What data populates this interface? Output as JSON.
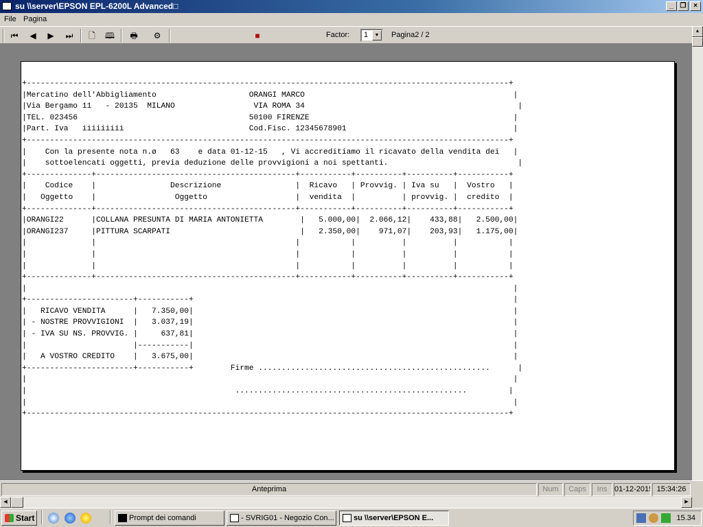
{
  "window": {
    "title": "su \\\\server\\EPSON EPL-6200L Advanced□"
  },
  "menu": {
    "file": "File",
    "page": "Pagina"
  },
  "toolbar": {
    "factor_label": "Factor:",
    "factor_value": "1",
    "page_indicator": "Pagina2 / 2",
    "icons": [
      "separator-grip-icon",
      "first-page-icon",
      "previous-page-icon",
      "next-page-icon",
      "last-page-icon",
      "single-page-icon",
      "two-pages-icon",
      "print-icon",
      "print-setup-icon",
      "exit-icon"
    ]
  },
  "report": {
    "lines": [
      "+--------------------------------------------------------------------------------------------------------+",
      "|Mercatino dell'Abbigliamento                    ORANGI MARCO                                             |",
      "|Via Bergamo 11   - 20135  MILANO                 VIA ROMA 34                                              |",
      "|TEL. 023456                                     50100 FIRENZE                                            |",
      "|Part. Iva   iiiiiiiii                           Cod.Fisc. 12345678901                                    |",
      "+--------------------------------------------------------------------------------------------------------+",
      "|    Con la presente nota n.ø   63    e data 01-12-15   , Vi accreditiamo il ricavato della vendita dei   |",
      "|    sottoelencati oggetti, previa deduzione delle provvigioni a noi spettanti.                            |",
      "+--------------+-------------------------------------------+-----------+----------+----------+-----------+",
      "|    Codice    |                Descrizione                |  Ricavo   | Provvig. | Iva su   |  Vostro   |",
      "|   Oggetto    |                 Oggetto                   |  vendita  |          | provvig. |  credito  |",
      "+--------------+-------------------------------------------+-----------+----------+----------+-----------+",
      "|ORANGI22      |COLLANA PRESUNTA DI MARIA ANTONIETTA        |   5.000,00|  2.066,12|    433,88|   2.500,00|",
      "|ORANGI237     |PITTURA SCARPATI                            |   2.350,00|    971,07|    203,93|   1.175,00|",
      "|              |                                           |           |          |          |           |",
      "|              |                                           |           |          |          |           |",
      "|              |                                           |           |          |          |           |",
      "+--------------+-------------------------------------------+-----------+----------+----------+-----------+",
      "|                                                                                                         |",
      "+-----------------------+-----------+                                                                     |",
      "|   RICAVO VENDITA      |   7.350,00|                                                                     |",
      "| - NOSTRE PROVVIGIONI  |   3.037,19|                                                                     |",
      "| - IVA SU NS. PROVVIG. |     637,81|                                                                     |",
      "|                       |-----------|                                                                     |",
      "|   A VOSTRO CREDITO    |   3.675,00|                                                                     |",
      "+-----------------------+-----------+        Firme ..................................................      |",
      "|                                                                                                         |",
      "|                                             ..................................................         |",
      "|                                                                                                         |",
      "+--------------------------------------------------------------------------------------------------------+"
    ]
  },
  "statusbar": {
    "center": "Anteprima",
    "num": "Num",
    "caps": "Caps",
    "ins": "Ins",
    "date": "01-12-2015",
    "time": "15:34:26"
  },
  "taskbar": {
    "start": "Start",
    "tasks": [
      {
        "label": "Prompt dei comandi"
      },
      {
        "label": "- SVRIG01 - Negozio Con..."
      },
      {
        "label": "su \\\\server\\EPSON E..."
      }
    ],
    "clock": "15.34"
  }
}
